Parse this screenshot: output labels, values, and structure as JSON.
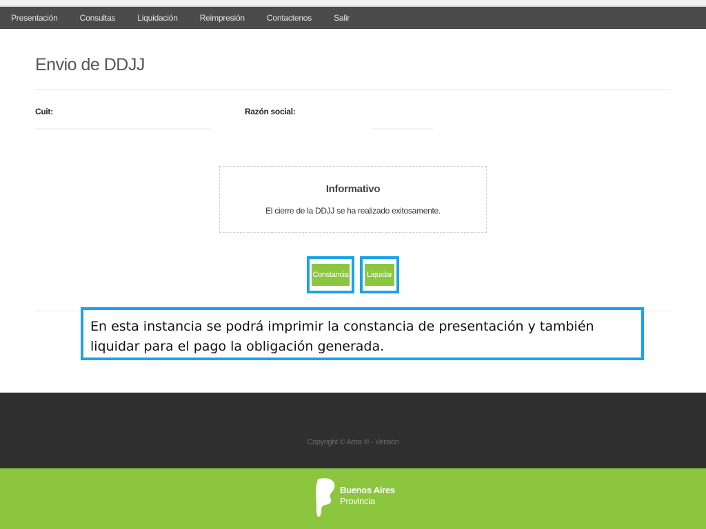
{
  "nav": {
    "items": [
      {
        "label": "Presentación"
      },
      {
        "label": "Consultas"
      },
      {
        "label": "Liquidación"
      },
      {
        "label": "Reimpresión"
      },
      {
        "label": "Contactenos"
      },
      {
        "label": "Salir"
      }
    ]
  },
  "page": {
    "title": "Envio de DDJJ",
    "cuit_label": "Cuit:",
    "razon_label": "Razón social:"
  },
  "info": {
    "title": "Informativo",
    "message": "El cierre de la DDJJ se ha realizado exitosamente."
  },
  "buttons": {
    "constancia": "Constancia",
    "liquidar": "Liquidar"
  },
  "callout": {
    "text": "En esta instancia se podrá imprimir la constancia de presentación y también liquidar para el pago la obligación generada."
  },
  "footer": {
    "copyright": "Copyright © Arba ® - Versión"
  },
  "logo": {
    "line1": "Buenos Aires",
    "line2": "Provincia"
  },
  "colors": {
    "navbar": "#4b4b4b",
    "button_green": "#8cc63f",
    "highlight_blue": "#1aa3e8",
    "footer_dark": "#2f2f2f",
    "footer_green": "#8cc63f"
  }
}
